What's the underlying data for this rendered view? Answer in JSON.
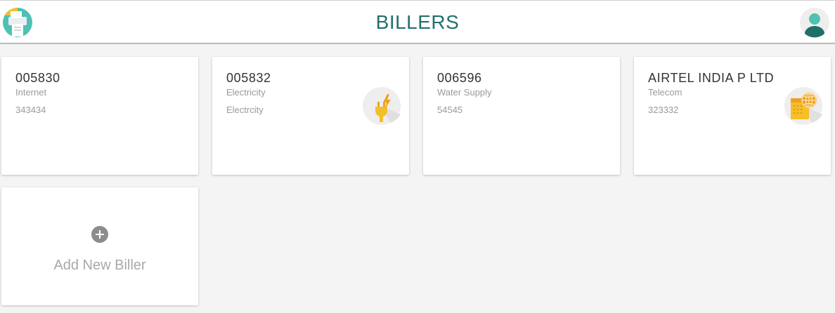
{
  "header": {
    "title": "BILLERS",
    "logo_icon": "bill-print-icon",
    "avatar_icon": "user-avatar-icon"
  },
  "billers": [
    {
      "number": "005830",
      "category": "Internet",
      "reference": "343434",
      "icon": null
    },
    {
      "number": "005832",
      "category": "Electricity",
      "reference": "Electrcity",
      "icon": "electricity-plug-icon"
    },
    {
      "number": "006596",
      "category": "Water Supply",
      "reference": "54545",
      "icon": null
    },
    {
      "number": "AIRTEL INDIA P LTD",
      "category": "Telecom",
      "reference": "323332",
      "icon": "telecom-globe-icon"
    }
  ],
  "add_biller": {
    "label": "Add New Biller",
    "icon": "plus-circle-icon"
  },
  "colors": {
    "accent": "#23706e",
    "background": "#f4f4f4",
    "card": "#ffffff",
    "muted_text": "#9a9a9a",
    "icon_yellow": "#f5bf2a",
    "icon_orange": "#f0a020"
  }
}
